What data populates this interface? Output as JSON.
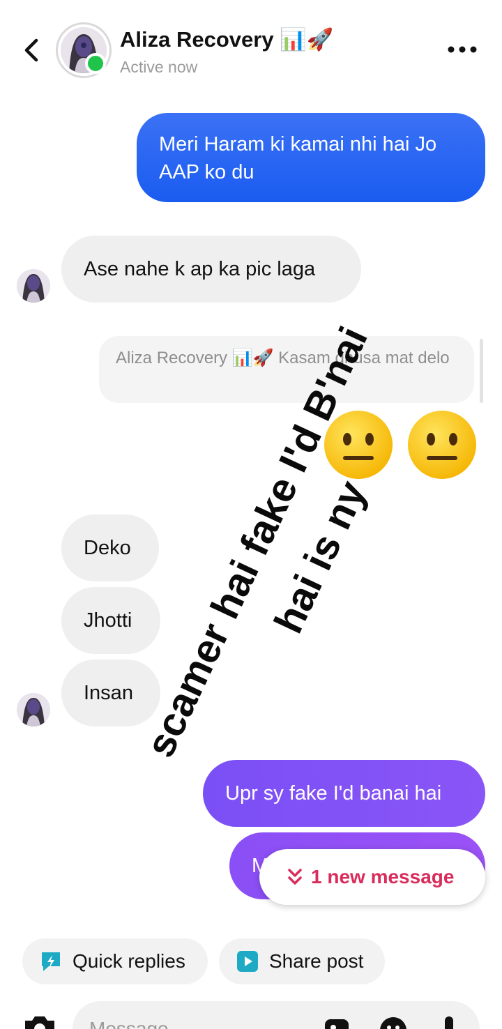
{
  "header": {
    "title": "Aliza Recovery 📊🚀",
    "status": "Active now"
  },
  "messages": {
    "sent_1": "Meri Haram ki kamai nhi hai Jo AAP ko du",
    "received_1": "Ase nahe k ap ka pic laga",
    "reply_quote": "Aliza Recovery 📊🚀 Kasam ghusa mat delo",
    "reaction_emoji": "😐",
    "received_2": "Deko",
    "received_3": "Jhotti",
    "received_4": "Insan",
    "sent_2": "Upr sy fake I'd banai hai",
    "sent_3_partial": "M"
  },
  "overlay": {
    "line_1": "scamer hai fake I'd B'nai",
    "line_2": "hai is ny"
  },
  "new_message_pill": "1 new message",
  "quick_actions": {
    "quick_replies": "Quick replies",
    "share_post": "Share post"
  },
  "composer": {
    "placeholder": "Message..."
  },
  "colors": {
    "sent_blue": "#1a5cf0",
    "sent_purple": "#8a55f7",
    "received_bg": "#efefef",
    "online": "#21c44a",
    "new_message_accent": "#d92c5b"
  }
}
